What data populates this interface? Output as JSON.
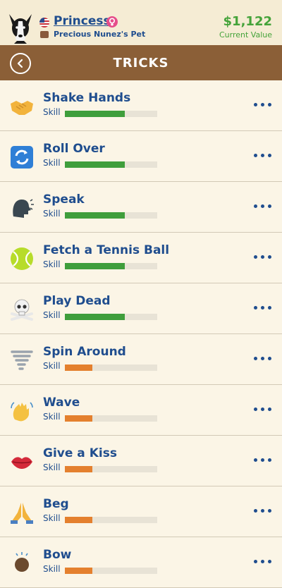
{
  "pet": {
    "name": "Princess",
    "owner": "Precious Nunez's Pet",
    "value": "$1,122",
    "value_label": "Current Value"
  },
  "header": {
    "title": "TRICKS"
  },
  "colors": {
    "high_skill": "#3f9e3c",
    "low_skill": "#e4802e",
    "title_bar": "#8b5f37",
    "text_blue": "#1f4d8e"
  },
  "tricks": [
    {
      "name": "Shake Hands",
      "skill_label": "Skill",
      "skill": 0.65,
      "icon": "handshake-icon"
    },
    {
      "name": "Roll Over",
      "skill_label": "Skill",
      "skill": 0.65,
      "icon": "arrows-cycle-icon"
    },
    {
      "name": "Speak",
      "skill_label": "Skill",
      "skill": 0.65,
      "icon": "speaking-head-icon"
    },
    {
      "name": "Fetch a Tennis Ball",
      "skill_label": "Skill",
      "skill": 0.65,
      "icon": "tennis-ball-icon"
    },
    {
      "name": "Play Dead",
      "skill_label": "Skill",
      "skill": 0.65,
      "icon": "skull-crossbones-icon"
    },
    {
      "name": "Spin Around",
      "skill_label": "Skill",
      "skill": 0.3,
      "icon": "tornado-icon"
    },
    {
      "name": "Wave",
      "skill_label": "Skill",
      "skill": 0.3,
      "icon": "waving-hand-icon"
    },
    {
      "name": "Give a Kiss",
      "skill_label": "Skill",
      "skill": 0.3,
      "icon": "lips-icon"
    },
    {
      "name": "Beg",
      "skill_label": "Skill",
      "skill": 0.3,
      "icon": "folded-hands-icon"
    },
    {
      "name": "Bow",
      "skill_label": "Skill",
      "skill": 0.3,
      "icon": "bowing-person-icon"
    }
  ]
}
